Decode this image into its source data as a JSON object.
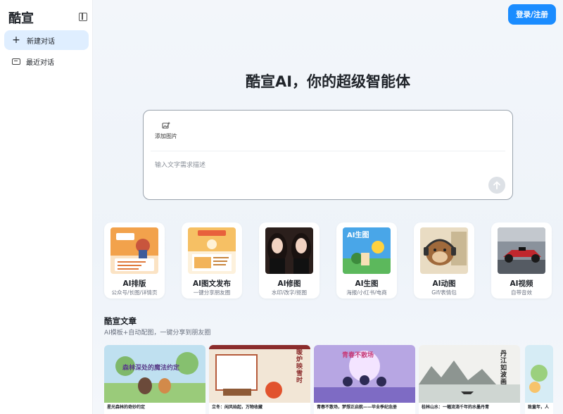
{
  "sidebar": {
    "brand": "酷宣",
    "items": [
      {
        "label": "新建对话",
        "icon": "plus-icon"
      },
      {
        "label": "最近对话",
        "icon": "chat-icon"
      }
    ]
  },
  "header": {
    "login_label": "登录/注册"
  },
  "hero": {
    "title": "酷宣AI，你的超级智能体"
  },
  "composer": {
    "add_image_label": "添加图片",
    "placeholder": "输入文字需求描述",
    "value": ""
  },
  "tools": [
    {
      "name": "AI排版",
      "desc": "公众号/长图/详情页",
      "thumb_text": "一起新年",
      "color": "#f2a24c"
    },
    {
      "name": "AI图文发布",
      "desc": "一键分享朋友圈",
      "thumb_text": "教师节快乐",
      "color": "#f6c064"
    },
    {
      "name": "AI修图",
      "desc": "水印/改字/抠图",
      "thumb_text": "",
      "color": "#3b2b26"
    },
    {
      "name": "AI生图",
      "desc": "海报/小红书/电商",
      "thumb_text": "AI生图",
      "color": "#49a6e8"
    },
    {
      "name": "AI动图",
      "desc": "Gif/表情包",
      "thumb_text": "",
      "color": "#d7c9ae"
    },
    {
      "name": "AI视频",
      "desc": "自带音效",
      "thumb_text": "",
      "color": "#6c7380"
    }
  ],
  "articles_section": {
    "title": "酷宣文章",
    "subtitle": "AI模板+自动配图，一键分享到朋友圈"
  },
  "articles": [
    {
      "caption": "星光森林的奇妙约定",
      "art_text": "森林深处的魔法约定"
    },
    {
      "caption": "立冬：闲风始起，万物收藏",
      "art_text": "暖炉映雪时"
    },
    {
      "caption": "青春不散场，梦想正启航——毕业季纪念册",
      "art_text": "青春不散场"
    },
    {
      "caption": "桂林山水：一幅流淌千年的水墨丹青",
      "art_text": "丹江如波画"
    },
    {
      "caption": "致童年，人",
      "art_text": ""
    }
  ]
}
